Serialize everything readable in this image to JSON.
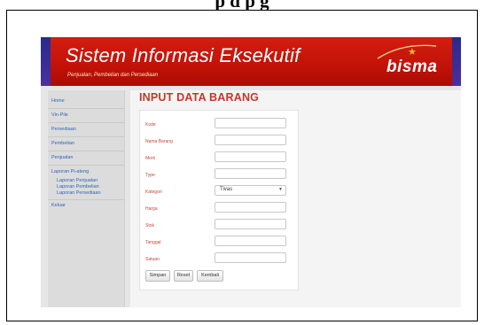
{
  "document": {
    "heading": "p     d                p                g"
  },
  "app": {
    "title": "Sistem Informasi Eksekutif",
    "subtitle": "Penjualan, Pembelian dan Persediaan",
    "logo_text": "bisma",
    "colors": {
      "header_red": "#c21208",
      "header_stripe_purple": "#3b2a96",
      "form_title_red": "#c0392b",
      "nav_link_blue": "#2f64b5",
      "logo_star_orange": "#f3b332"
    }
  },
  "sidebar": {
    "items": [
      {
        "label": "Home"
      },
      {
        "label": "Vin-Pile"
      },
      {
        "label": "Persediaan"
      },
      {
        "label": "Pembelian"
      },
      {
        "label": "Penjualan"
      },
      {
        "label": "Laporan Pi-ateng"
      },
      {
        "label": "Laporan Penjualan"
      },
      {
        "label": "Laporan Pembelian"
      },
      {
        "label": "Laporan Persediaan"
      },
      {
        "label": "Keluar"
      }
    ]
  },
  "form": {
    "title": "INPUT DATA BARANG",
    "fields": [
      {
        "label": "Kode",
        "value": ""
      },
      {
        "label": "Nama Barang",
        "value": ""
      },
      {
        "label": "Merk",
        "value": ""
      },
      {
        "label": "Type",
        "value": ""
      },
      {
        "label": "Kategori",
        "value": "Tivas",
        "kind": "select"
      },
      {
        "label": "Harga",
        "value": ""
      },
      {
        "label": "Stok",
        "value": ""
      },
      {
        "label": "Tanggal",
        "value": ""
      },
      {
        "label": "Satuan",
        "value": ""
      }
    ],
    "buttons": {
      "submit": "Simpan",
      "reset": "Reset",
      "back": "Kembali"
    },
    "select_arrow_icon": "triangle-down"
  }
}
